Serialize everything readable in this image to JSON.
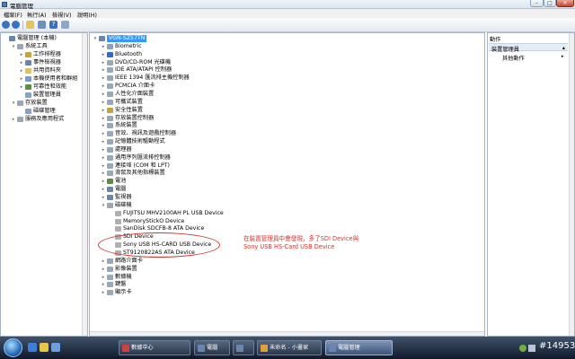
{
  "window": {
    "title": "電腦管理"
  },
  "menu": [
    "檔案(F)",
    "執行(A)",
    "檢視(V)",
    "說明(H)"
  ],
  "toolbar": {
    "help_glyph": "?"
  },
  "left_tree": [
    {
      "label": "電腦管理 (本機)",
      "exp": "",
      "color": "#6b86ad"
    },
    {
      "label": "系統工具",
      "exp": "▾",
      "color": "#9aa7b8"
    },
    {
      "label": "工作排程器",
      "exp": "▸",
      "color": "#c7a43b"
    },
    {
      "label": "事件檢視器",
      "exp": "▸",
      "color": "#6b86ad"
    },
    {
      "label": "共用資料夾",
      "exp": "▸",
      "color": "#e0c060"
    },
    {
      "label": "本機使用者和群組",
      "exp": "▸",
      "color": "#7a9cc6"
    },
    {
      "label": "可靠性和效能",
      "exp": "▸",
      "color": "#5a8f3f"
    },
    {
      "label": "裝置管理員",
      "exp": "",
      "color": "#8aa1c2"
    },
    {
      "label": "存放裝置",
      "exp": "▾",
      "color": "#9aa7b8"
    },
    {
      "label": "磁碟管理",
      "exp": "",
      "color": "#8aa1c2"
    },
    {
      "label": "服務及應用程式",
      "exp": "▸",
      "color": "#9aa7b8"
    }
  ],
  "device_tree": [
    {
      "label": "VGN-SZ57TN",
      "exp": "▾",
      "color": "#6b86ad",
      "selected": true
    },
    {
      "label": "Biometric",
      "exp": "▸",
      "color": "#8aa1c2"
    },
    {
      "label": "Bluetooth",
      "exp": "▸",
      "color": "#2f6bc9"
    },
    {
      "label": "DVD/CD-ROM 光碟機",
      "exp": "▸",
      "color": "#9aa7b8"
    },
    {
      "label": "IDE ATA/ATAPI 控制器",
      "exp": "▸",
      "color": "#9aa7b8"
    },
    {
      "label": "IEEE 1394 匯流排主機控制器",
      "exp": "▸",
      "color": "#9aa7b8"
    },
    {
      "label": "PCMCIA 介面卡",
      "exp": "▸",
      "color": "#9aa7b8"
    },
    {
      "label": "人性化介面裝置",
      "exp": "▸",
      "color": "#9aa7b8"
    },
    {
      "label": "可攜式裝置",
      "exp": "▸",
      "color": "#9aa7b8"
    },
    {
      "label": "安全性裝置",
      "exp": "▸",
      "color": "#c7a43b"
    },
    {
      "label": "存放裝置控制器",
      "exp": "▸",
      "color": "#9aa7b8"
    },
    {
      "label": "系統裝置",
      "exp": "▸",
      "color": "#9aa7b8"
    },
    {
      "label": "音效、視訊及遊戲控制器",
      "exp": "▸",
      "color": "#9aa7b8"
    },
    {
      "label": "記憶體技術驅動程式",
      "exp": "▸",
      "color": "#9aa7b8"
    },
    {
      "label": "處理器",
      "exp": "▸",
      "color": "#9aa7b8"
    },
    {
      "label": "通用序列匯流排控制器",
      "exp": "▸",
      "color": "#9aa7b8"
    },
    {
      "label": "連接埠 (COM 和 LPT)",
      "exp": "▸",
      "color": "#9aa7b8"
    },
    {
      "label": "滑鼠及其他指標裝置",
      "exp": "▸",
      "color": "#9aa7b8"
    },
    {
      "label": "電池",
      "exp": "▸",
      "color": "#5a8f3f"
    },
    {
      "label": "電腦",
      "exp": "▸",
      "color": "#6b86ad"
    },
    {
      "label": "監視器",
      "exp": "▸",
      "color": "#6b86ad"
    },
    {
      "label": "磁碟機",
      "exp": "▾",
      "color": "#9aa7b8"
    },
    {
      "label": "FUJITSU MHV2100AH PL USB Device",
      "exp": "",
      "color": "#b0b0b0",
      "indent": 1
    },
    {
      "label": "MemoryStickO Device",
      "exp": "",
      "color": "#b0b0b0",
      "indent": 1
    },
    {
      "label": "SanDisk SDCFB-8 ATA Device",
      "exp": "",
      "color": "#b0b0b0",
      "indent": 1
    },
    {
      "label": "SDI Device",
      "exp": "",
      "color": "#b0b0b0",
      "indent": 1
    },
    {
      "label": "Sony USB  HS-CARD USB Device",
      "exp": "",
      "color": "#b0b0b0",
      "indent": 1
    },
    {
      "label": "ST9120822AS ATA Device",
      "exp": "",
      "color": "#b0b0b0",
      "indent": 1
    },
    {
      "label": "網路介面卡",
      "exp": "▸",
      "color": "#9aa7b8"
    },
    {
      "label": "影像裝置",
      "exp": "▸",
      "color": "#9aa7b8"
    },
    {
      "label": "數據機",
      "exp": "▸",
      "color": "#9aa7b8"
    },
    {
      "label": "鍵盤",
      "exp": "▸",
      "color": "#9aa7b8"
    },
    {
      "label": "顯示卡",
      "exp": "▸",
      "color": "#9aa7b8"
    }
  ],
  "actions": {
    "title": "動作",
    "section": "裝置管理員",
    "section_arrow": "▴",
    "item": "其他動作",
    "item_arrow": "▸"
  },
  "annotation": {
    "line1": "在裝置管理員中會發現，多了SDI Device與",
    "line2": "Sony USB HS-Card USB Device"
  },
  "taskbar": {
    "tasks": [
      {
        "label": "數據中心",
        "color": "#d04040"
      },
      {
        "label": "電腦",
        "color": "#6b86ad"
      },
      {
        "label": "",
        "color": "#6b86ad"
      },
      {
        "label": "未命名 - 小畫家",
        "color": "#e0a040"
      },
      {
        "label": "電腦管理",
        "color": "#6b86ad",
        "active": true
      }
    ]
  },
  "watermark": "#14953"
}
